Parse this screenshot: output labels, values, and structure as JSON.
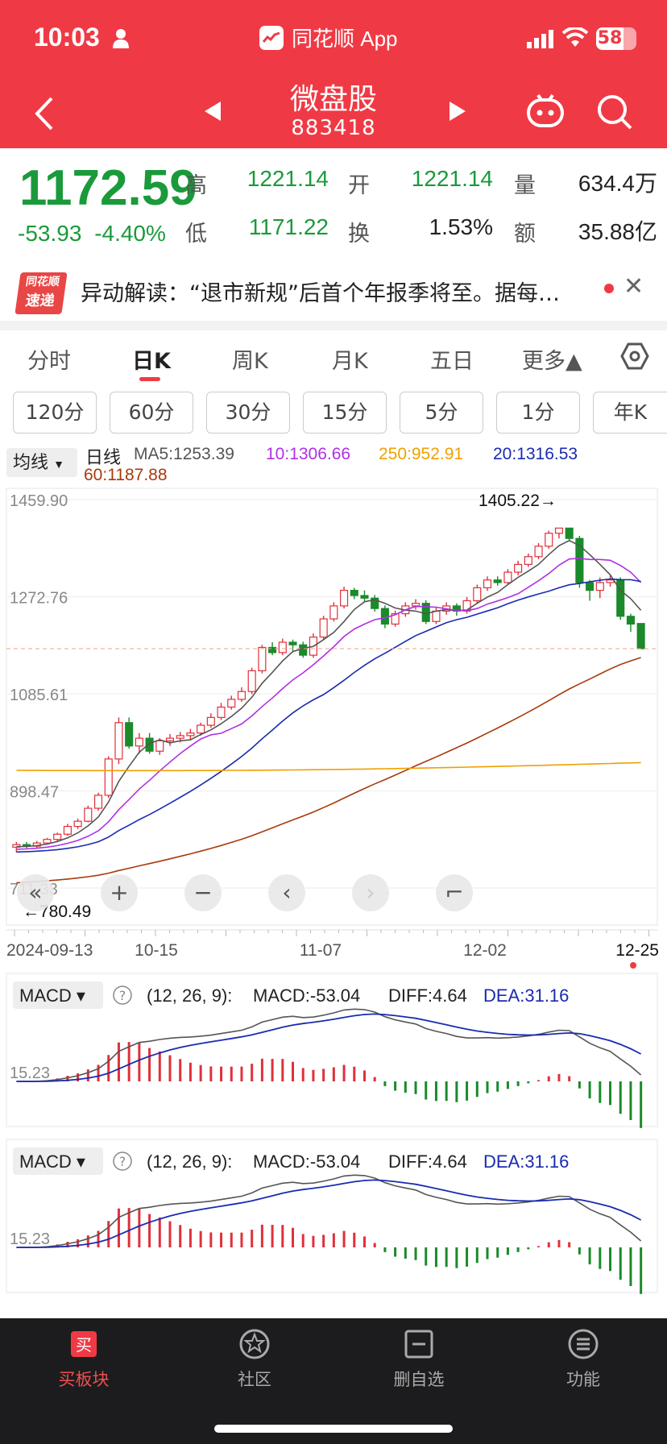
{
  "status": {
    "time": "10:03",
    "battery": "58"
  },
  "app": {
    "name": "同花顺 App"
  },
  "stock": {
    "name": "微盘股",
    "code": "883418"
  },
  "quote": {
    "price": "1172.59",
    "change": "-53.93",
    "change_pct": "-4.40%",
    "high_label": "高",
    "high": "1221.14",
    "open_label": "开",
    "open": "1221.14",
    "volume_label": "量",
    "volume": "634.4万",
    "low_label": "低",
    "low": "1171.22",
    "turnover_label": "换",
    "turnover": "1.53%",
    "amount_label": "额",
    "amount": "35.88亿"
  },
  "news": {
    "badge_top": "同花顺",
    "badge_bottom": "速递",
    "text": "异动解读：“退市新规”后首个年报季将至。据每…"
  },
  "tabs": [
    "分时",
    "日K",
    "周K",
    "月K",
    "五日",
    "更多▲"
  ],
  "periods": [
    "120分",
    "60分",
    "30分",
    "15分",
    "5分",
    "1分",
    "年K"
  ],
  "ma": {
    "selector": "均线",
    "kind": "日线",
    "ma5": "MA5:1253.39",
    "ma10": "10:1306.66",
    "ma250": "250:952.91",
    "ma20": "20:1316.53",
    "ma60": "60:1187.88",
    "colors": {
      "ma5": "#555555",
      "ma10": "#b030e8",
      "ma250": "#f0a000",
      "ma20": "#1a2bb0",
      "ma60": "#a83a0a"
    }
  },
  "chart_data": [
    {
      "type": "candlestick",
      "y_ticks": [
        "1459.90",
        "1272.76",
        "1085.61",
        "898.47",
        "711.33"
      ],
      "ylim": [
        711.33,
        1459.9
      ],
      "max_label": "1405.22→",
      "min_label": "←780.49",
      "x_labels": [
        "2024-09-13",
        "10-15",
        "11-07",
        "12-02",
        "12-25"
      ],
      "candles": [
        [
          790,
          795,
          800,
          780
        ],
        [
          795,
          792,
          800,
          788
        ],
        [
          792,
          798,
          802,
          788
        ],
        [
          798,
          805,
          808,
          795
        ],
        [
          805,
          815,
          818,
          800
        ],
        [
          815,
          830,
          835,
          812
        ],
        [
          830,
          840,
          845,
          825
        ],
        [
          840,
          865,
          870,
          838
        ],
        [
          865,
          890,
          895,
          860
        ],
        [
          890,
          960,
          965,
          885
        ],
        [
          960,
          1030,
          1040,
          950
        ],
        [
          1030,
          985,
          1040,
          980
        ],
        [
          985,
          1000,
          1010,
          970
        ],
        [
          1000,
          975,
          1010,
          970
        ],
        [
          975,
          995,
          1000,
          968
        ],
        [
          995,
          1000,
          1008,
          985
        ],
        [
          1000,
          1005,
          1012,
          992
        ],
        [
          1005,
          1010,
          1018,
          998
        ],
        [
          1010,
          1025,
          1030,
          1005
        ],
        [
          1025,
          1040,
          1048,
          1020
        ],
        [
          1040,
          1060,
          1068,
          1035
        ],
        [
          1060,
          1075,
          1082,
          1055
        ],
        [
          1075,
          1090,
          1098,
          1070
        ],
        [
          1090,
          1130,
          1136,
          1085
        ],
        [
          1130,
          1175,
          1180,
          1125
        ],
        [
          1175,
          1165,
          1185,
          1160
        ],
        [
          1165,
          1185,
          1192,
          1160
        ],
        [
          1185,
          1180,
          1190,
          1168
        ],
        [
          1180,
          1160,
          1186,
          1155
        ],
        [
          1160,
          1195,
          1202,
          1155
        ],
        [
          1195,
          1230,
          1236,
          1190
        ],
        [
          1230,
          1255,
          1262,
          1225
        ],
        [
          1255,
          1285,
          1292,
          1250
        ],
        [
          1285,
          1275,
          1290,
          1268
        ],
        [
          1275,
          1270,
          1285,
          1262
        ],
        [
          1270,
          1250,
          1276,
          1244
        ],
        [
          1250,
          1220,
          1256,
          1212
        ],
        [
          1220,
          1240,
          1246,
          1215
        ],
        [
          1240,
          1255,
          1262,
          1234
        ],
        [
          1255,
          1260,
          1268,
          1248
        ],
        [
          1260,
          1225,
          1266,
          1220
        ],
        [
          1225,
          1245,
          1252,
          1220
        ],
        [
          1245,
          1255,
          1262,
          1238
        ],
        [
          1255,
          1245,
          1260,
          1236
        ],
        [
          1245,
          1265,
          1272,
          1240
        ],
        [
          1265,
          1290,
          1296,
          1260
        ],
        [
          1290,
          1305,
          1312,
          1284
        ],
        [
          1305,
          1300,
          1312,
          1294
        ],
        [
          1300,
          1320,
          1326,
          1296
        ],
        [
          1320,
          1335,
          1342,
          1314
        ],
        [
          1335,
          1350,
          1356,
          1330
        ],
        [
          1350,
          1370,
          1376,
          1345
        ],
        [
          1370,
          1395,
          1400,
          1365
        ],
        [
          1395,
          1405,
          1405,
          1385
        ],
        [
          1405,
          1385,
          1405,
          1380
        ],
        [
          1385,
          1300,
          1390,
          1290
        ],
        [
          1300,
          1285,
          1305,
          1265
        ],
        [
          1285,
          1300,
          1310,
          1270
        ],
        [
          1300,
          1305,
          1315,
          1292
        ],
        [
          1305,
          1235,
          1310,
          1228
        ],
        [
          1235,
          1220,
          1240,
          1205
        ],
        [
          1221.14,
          1172.59,
          1221.14,
          1171.22
        ]
      ],
      "series": [
        {
          "name": "MA5",
          "color": "#555555"
        },
        {
          "name": "10",
          "color": "#b030e8"
        },
        {
          "name": "20",
          "color": "#1a2bb0"
        },
        {
          "name": "60",
          "color": "#a83a0a"
        },
        {
          "name": "250",
          "color": "#f0a000"
        }
      ]
    },
    {
      "type": "bar",
      "indicator": "MACD",
      "params": "(12, 26, 9):",
      "macd": "MACD:-53.04",
      "diff": "DIFF:4.64",
      "dea": "DEA:31.16",
      "zero_label": "15.23"
    }
  ],
  "chart_controls": [
    "collapse",
    "zoom-in",
    "zoom-out",
    "prev",
    "next",
    "fullscreen"
  ],
  "bottom_nav": [
    {
      "label": "买板块",
      "icon": "buy-icon"
    },
    {
      "label": "社区",
      "icon": "community-icon"
    },
    {
      "label": "删自选",
      "icon": "remove-watch-icon"
    },
    {
      "label": "功能",
      "icon": "menu-icon"
    }
  ]
}
